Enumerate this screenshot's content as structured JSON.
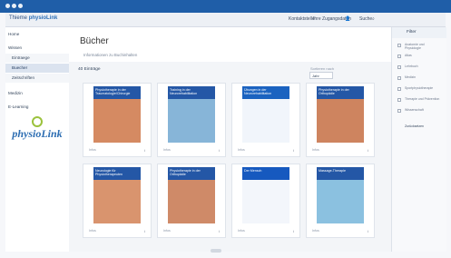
{
  "window": {
    "title": "physioLink"
  },
  "topbar": {
    "brand_prefix": "Thieme",
    "brand_name": "physioLink",
    "links": [
      "Kontaktstelle",
      "Ihre Zugangsdaten",
      "Suche"
    ],
    "icons": [
      "user-icon",
      "search-icon",
      "close-icon"
    ]
  },
  "sidebar": {
    "items": [
      {
        "label": "Home"
      },
      {
        "label": "Wissen"
      },
      {
        "label": "Eintraege"
      },
      {
        "label": "Buecher"
      },
      {
        "label": "Zeitschriften"
      },
      {
        "label": "Medizin"
      },
      {
        "label": "E-Learning"
      }
    ],
    "logo_text": "physioLink"
  },
  "main": {
    "title": "Bücher",
    "subtitle": "Informationen zu Buchinhalten",
    "count_label": "40 Einträge",
    "sort_label": "Sortieren nach",
    "sort_value": "Jahr"
  },
  "books": [
    {
      "title": "Physiotherapie in der Traumatologie/Chirurgie",
      "meta": "Infos",
      "cover_color": "#2457a6",
      "image_color": "#d58a62"
    },
    {
      "title": "Training in der Neurorehabilitation",
      "meta": "Infos",
      "cover_color": "#2457a6",
      "image_color": "#87b5d8"
    },
    {
      "title": "Übungen in der Neurorehabilitation",
      "meta": "Infos",
      "cover_color": "#1b63c0",
      "image_color": "#f1f5fb"
    },
    {
      "title": "Physiotherapie in der Orthopädie",
      "meta": "Infos",
      "cover_color": "#2457a6",
      "image_color": "#ce845f"
    },
    {
      "title": "Neurologie für Physiotherapeuten",
      "meta": "Infos",
      "cover_color": "#2457a6",
      "image_color": "#d9946e"
    },
    {
      "title": "Physiotherapie in der Orthopädie",
      "meta": "Infos",
      "cover_color": "#2457a6",
      "image_color": "#cf8a68"
    },
    {
      "title": "Der Mensch",
      "meta": "Infos",
      "cover_color": "#1659bf",
      "image_color": "#f3f6fb"
    },
    {
      "title": "Massage-Therapie",
      "meta": "Infos",
      "cover_color": "#2457a6",
      "image_color": "#8bc1e0"
    }
  ],
  "filter": {
    "title": "Filter",
    "items": [
      "Anatomie und Physiologie",
      "Atlas",
      "Lehrbuch",
      "Medizin",
      "Sportphysiotherapie",
      "Therapie und Prävention",
      "Wissenschaft"
    ],
    "button_label": "Zurücksetzen"
  }
}
